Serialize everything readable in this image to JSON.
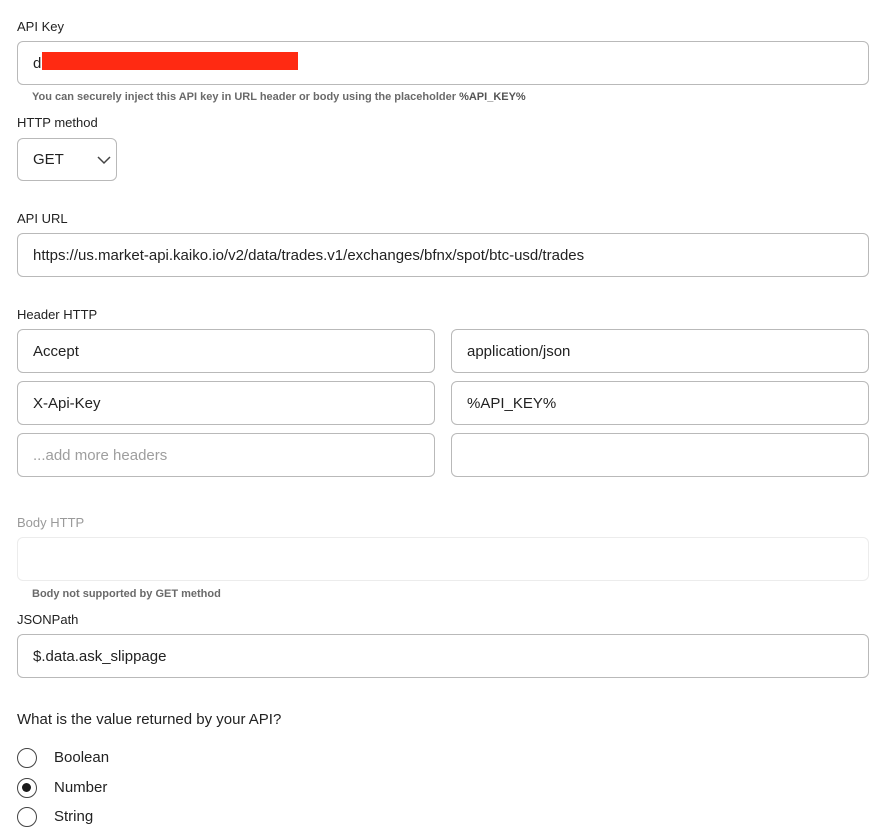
{
  "api_key": {
    "label": "API Key",
    "value": "d",
    "hint_prefix": "You can securely inject this API key in URL header or body using the placeholder ",
    "hint_placeholder": "%API_KEY%"
  },
  "http_method": {
    "label": "HTTP method",
    "selected": "GET"
  },
  "api_url": {
    "label": "API URL",
    "value": "https://us.market-api.kaiko.io/v2/data/trades.v1/exchanges/bfnx/spot/btc-usd/trades"
  },
  "headers": {
    "label": "Header HTTP",
    "rows": [
      {
        "name": "Accept",
        "value": "application/json"
      },
      {
        "name": "X-Api-Key",
        "value": "%API_KEY%"
      }
    ],
    "new_name_placeholder": "...add more headers"
  },
  "body": {
    "label": "Body HTTP",
    "hint": "Body not supported by GET method"
  },
  "jsonpath": {
    "label": "JSONPath",
    "value": "$.data.ask_slippage"
  },
  "return_type": {
    "question": "What is the value returned by your API?",
    "options": [
      {
        "label": "Boolean",
        "checked": false
      },
      {
        "label": "Number",
        "checked": true
      },
      {
        "label": "String",
        "checked": false
      }
    ]
  }
}
